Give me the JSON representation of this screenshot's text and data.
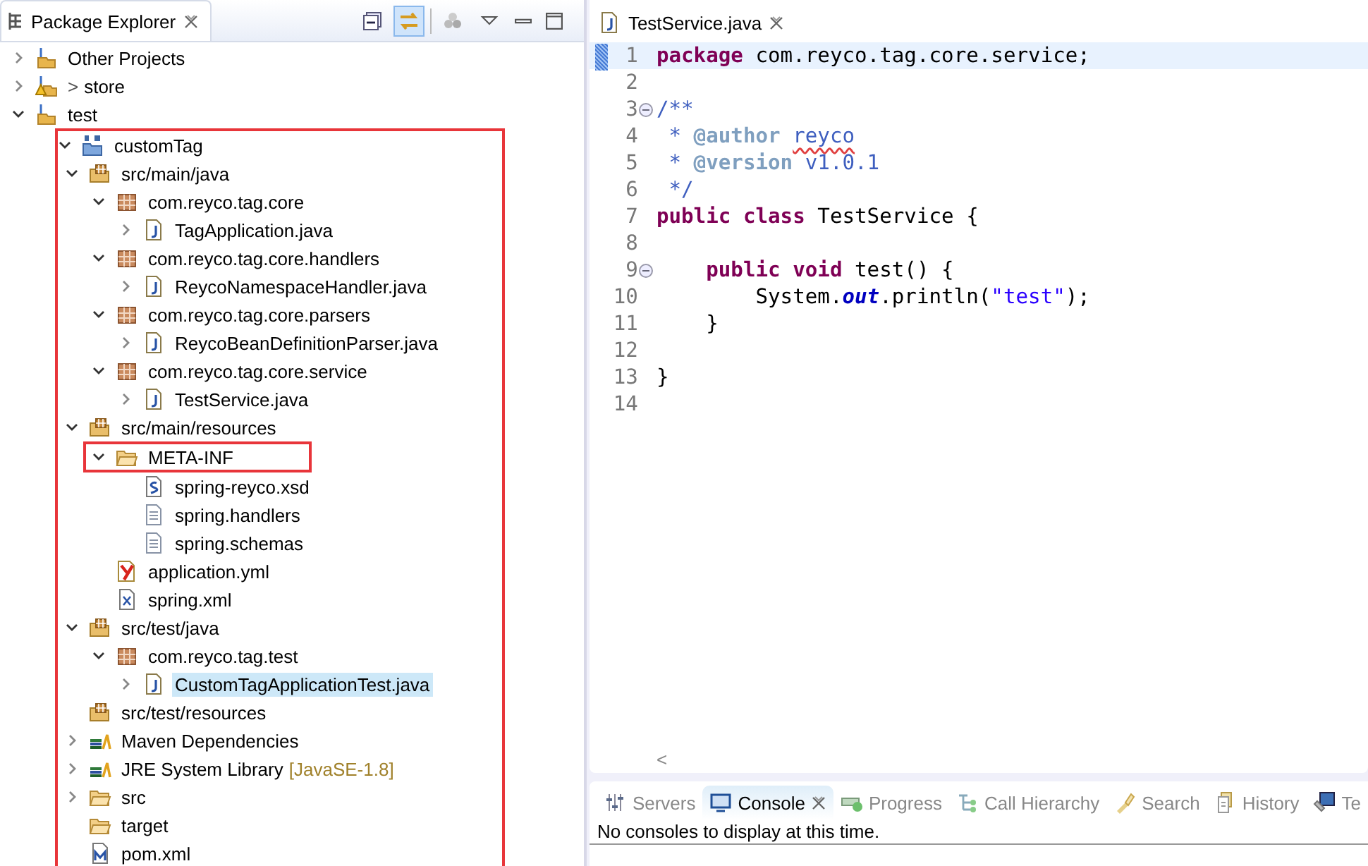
{
  "explorer": {
    "title": "Package Explorer",
    "toolbar": [
      {
        "kind": "collapse",
        "on": false
      },
      {
        "kind": "link",
        "on": true
      },
      {
        "kind": "filter",
        "on": false
      },
      {
        "kind": "menu",
        "on": false
      },
      {
        "kind": "minimize",
        "on": false
      },
      {
        "kind": "maximize",
        "on": false
      }
    ],
    "tree": [
      {
        "label": "Other Projects",
        "kind": "working-set",
        "expanded": false,
        "selected": false
      },
      {
        "label": "store",
        "prefix": ">",
        "kind": "working-set-warn",
        "expanded": false,
        "selected": false
      },
      {
        "label": "test",
        "kind": "working-set",
        "expanded": true,
        "selected": false,
        "children": [
          {
            "label": "customTag",
            "kind": "maven-project",
            "expanded": true,
            "selected": false,
            "highlighted_subtree": true,
            "children": [
              {
                "label": "src/main/java",
                "kind": "source-folder",
                "expanded": true,
                "selected": false,
                "children": [
                  {
                    "label": "com.reyco.tag.core",
                    "kind": "package",
                    "expanded": true,
                    "selected": false,
                    "children": [
                      {
                        "label": "TagApplication.java",
                        "kind": "java",
                        "expanded": false,
                        "selected": false
                      }
                    ]
                  },
                  {
                    "label": "com.reyco.tag.core.handlers",
                    "kind": "package",
                    "expanded": true,
                    "selected": false,
                    "children": [
                      {
                        "label": "ReycoNamespaceHandler.java",
                        "kind": "java",
                        "expanded": false,
                        "selected": false
                      }
                    ]
                  },
                  {
                    "label": "com.reyco.tag.core.parsers",
                    "kind": "package",
                    "expanded": true,
                    "selected": false,
                    "children": [
                      {
                        "label": "ReycoBeanDefinitionParser.java",
                        "kind": "java",
                        "expanded": false,
                        "selected": false
                      }
                    ]
                  },
                  {
                    "label": "com.reyco.tag.core.service",
                    "kind": "package",
                    "expanded": true,
                    "selected": false,
                    "children": [
                      {
                        "label": "TestService.java",
                        "kind": "java",
                        "expanded": false,
                        "selected": false
                      }
                    ]
                  }
                ]
              },
              {
                "label": "src/main/resources",
                "kind": "source-folder",
                "expanded": true,
                "selected": false,
                "children": [
                  {
                    "label": "META-INF",
                    "kind": "folder",
                    "expanded": true,
                    "selected": false,
                    "highlighted_row": true,
                    "children": [
                      {
                        "label": "spring-reyco.xsd",
                        "kind": "xsd",
                        "selected": false
                      },
                      {
                        "label": "spring.handlers",
                        "kind": "text",
                        "selected": false
                      },
                      {
                        "label": "spring.schemas",
                        "kind": "text",
                        "selected": false
                      }
                    ]
                  },
                  {
                    "label": "application.yml",
                    "kind": "yml",
                    "selected": false
                  },
                  {
                    "label": "spring.xml",
                    "kind": "xml",
                    "selected": false
                  }
                ]
              },
              {
                "label": "src/test/java",
                "kind": "source-folder",
                "expanded": true,
                "selected": false,
                "children": [
                  {
                    "label": "com.reyco.tag.test",
                    "kind": "package",
                    "expanded": true,
                    "selected": false,
                    "children": [
                      {
                        "label": "CustomTagApplicationTest.java",
                        "kind": "java",
                        "expanded": false,
                        "selected": true
                      }
                    ]
                  }
                ]
              },
              {
                "label": "src/test/resources",
                "kind": "source-folder",
                "selected": false
              },
              {
                "label": "Maven Dependencies",
                "kind": "library",
                "expanded": false,
                "selected": false
              },
              {
                "label": "JRE System Library",
                "decoration": "[JavaSE-1.8]",
                "kind": "library",
                "expanded": false,
                "selected": false
              },
              {
                "label": "src",
                "kind": "folder",
                "expanded": false,
                "selected": false
              },
              {
                "label": "target",
                "kind": "folder",
                "selected": false
              },
              {
                "label": "pom.xml",
                "kind": "pom",
                "selected": false
              }
            ]
          }
        ]
      }
    ]
  },
  "editor": {
    "tab": {
      "title": "TestService.java",
      "selected": true
    },
    "scroll_marker": "<",
    "lines": [
      {
        "number": "1",
        "current": true,
        "tokens": [
          {
            "kind": "keyword",
            "text": "package"
          },
          {
            "kind": "plain",
            "text": " com.reyco.tag.core.service;"
          }
        ]
      },
      {
        "number": "2"
      },
      {
        "number": "3",
        "fold": true,
        "tokens": [
          {
            "kind": "javadoc",
            "text": "/**"
          }
        ]
      },
      {
        "number": "4",
        "tokens": [
          {
            "kind": "javadoc",
            "text": " * "
          },
          {
            "kind": "javadoc-tag",
            "text": "@author "
          },
          {
            "kind": "misspelled",
            "text": "reyco"
          }
        ]
      },
      {
        "number": "5",
        "tokens": [
          {
            "kind": "javadoc",
            "text": " * "
          },
          {
            "kind": "javadoc-tag",
            "text": "@version"
          },
          {
            "kind": "javadoc",
            "text": " v1.0.1"
          }
        ]
      },
      {
        "number": "6",
        "tokens": [
          {
            "kind": "javadoc",
            "text": " */"
          }
        ]
      },
      {
        "number": "7",
        "tokens": [
          {
            "kind": "keyword",
            "text": "public class"
          },
          {
            "kind": "plain",
            "text": " TestService {"
          }
        ]
      },
      {
        "number": "8"
      },
      {
        "number": "9",
        "fold": true,
        "tokens": [
          {
            "kind": "keyword",
            "text": "    public void"
          },
          {
            "kind": "plain",
            "text": " test() {"
          }
        ]
      },
      {
        "number": "10",
        "tokens": [
          {
            "kind": "plain",
            "text": "        System."
          },
          {
            "kind": "field",
            "text": "out"
          },
          {
            "kind": "plain",
            "text": ".println("
          },
          {
            "kind": "string",
            "text": "\"test\""
          },
          {
            "kind": "plain",
            "text": ");"
          }
        ]
      },
      {
        "number": "11",
        "tokens": [
          {
            "kind": "plain",
            "text": "    }"
          }
        ]
      },
      {
        "number": "12"
      },
      {
        "number": "13",
        "tokens": [
          {
            "kind": "plain",
            "text": "}"
          }
        ]
      },
      {
        "number": "14"
      }
    ]
  },
  "bottom_panel": {
    "tabs": [
      {
        "label": "Servers",
        "kind": "servers",
        "selected": false
      },
      {
        "label": "Console",
        "kind": "console",
        "selected": true
      },
      {
        "label": "Progress",
        "kind": "progress",
        "selected": false
      },
      {
        "label": "Call Hierarchy",
        "kind": "hierarchy",
        "selected": false
      },
      {
        "label": "Search",
        "kind": "search",
        "selected": false
      },
      {
        "label": "History",
        "kind": "history",
        "selected": false
      },
      {
        "label": "Te",
        "kind": "terminal",
        "selected": false
      }
    ],
    "message": "No consoles to display at this time."
  }
}
